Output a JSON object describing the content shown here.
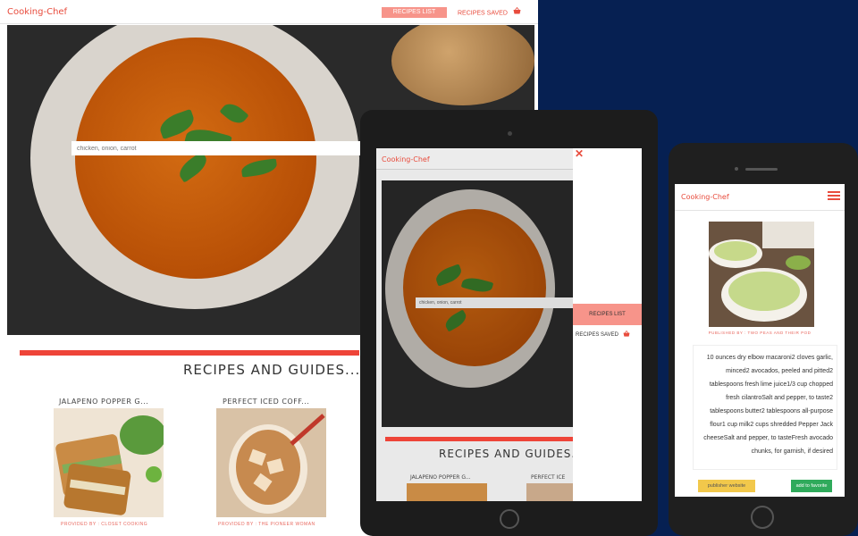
{
  "desktop": {
    "brand": "Cooking-Chef",
    "nav": {
      "recipes_list": "RECIPES LIST",
      "recipes_saved": "RECIPES SAVED"
    },
    "search": {
      "placeholder": "chicken, onion, carrot"
    },
    "heading": "RECIPES AND GUIDES...",
    "cards": [
      {
        "title": "JALAPENO POPPER G...",
        "provider": "PROVIDED BY : CLOSET COOKING"
      },
      {
        "title": "PERFECT ICED COFF...",
        "provider": "PROVIDED BY : THE PIONEER WOMAN"
      }
    ]
  },
  "tablet": {
    "brand": "Cooking-Chef",
    "search": {
      "placeholder": "chicken, onion, carrot"
    },
    "heading": "RECIPES AND GUIDES...",
    "cards": [
      {
        "title": "JALAPENO POPPER G..."
      },
      {
        "title": "PERFECT ICE"
      }
    ],
    "drawer": {
      "close": "✕",
      "recipes_list": "RECIPES LIST",
      "recipes_saved": "RECIPES SAVED"
    }
  },
  "phone": {
    "brand": "Cooking-Chef",
    "provider": "PUBLISHED BY : TWO PEAS AND THEIR POD",
    "ingredients": "10 ounces dry elbow macaroni2 cloves garlic, minced2 avocados, peeled and pitted2 tablespoons fresh lime juice1/3 cup chopped fresh cilantroSalt and pepper, to taste2 tablespoons butter2 tablespoons all-purpose flour1 cup milk2 cups shredded Pepper Jack cheeseSalt and pepper, to tasteFresh avocado chunks, for garnish, if desired",
    "buttons": {
      "publisher": "publisher website",
      "favorite": "add to favorite"
    }
  },
  "colors": {
    "brand": "#e84c3d",
    "accent_pink": "#f7948a",
    "navy": "#062052",
    "bar_red": "#ee4438"
  },
  "icons": [
    "basket-icon",
    "close-icon",
    "menu-icon"
  ]
}
